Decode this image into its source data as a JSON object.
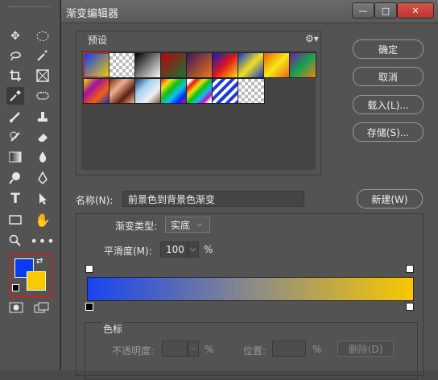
{
  "dialog": {
    "title": "渐变编辑器",
    "presets_label": "预设",
    "buttons": {
      "ok": "确定",
      "cancel": "取消",
      "load": "载入(L)...",
      "save": "存储(S)...",
      "new": "新建(W)"
    },
    "name_label": "名称(N):",
    "name_value": "前景色到背景色渐变",
    "gradient_type_label": "渐变类型:",
    "gradient_type_value": "实底",
    "smoothness_label": "平滑度(M):",
    "smoothness_value": "100",
    "smoothness_unit": "%",
    "stops_section_label": "色标",
    "opacity_label": "不透明度:",
    "opacity_unit": "%",
    "location_label": "位置:",
    "location_unit": "%",
    "delete_label": "删除(D)"
  },
  "colors": {
    "foreground": "#0a3cf8",
    "background": "#f8c800",
    "gradient_start": "#1844f0",
    "gradient_end": "#f9c800",
    "selection_highlight": "#d0201e"
  },
  "window_controls": {
    "minimize": "—",
    "maximize": "□",
    "close": "✕"
  },
  "presets": [
    {
      "id": "fg-to-bg",
      "css": "linear-gradient(135deg,#0a3cf8,#f8c800)",
      "selected": true
    },
    {
      "id": "fg-to-transparent",
      "css": "checker-blue"
    },
    {
      "id": "black-white",
      "css": "linear-gradient(135deg,#000,#fff)"
    },
    {
      "id": "red-green",
      "css": "linear-gradient(135deg,#c00010,#0b7a2e)"
    },
    {
      "id": "violet-orange",
      "css": "linear-gradient(135deg,#3a145a,#f07818)"
    },
    {
      "id": "blue-red-yellow",
      "css": "linear-gradient(135deg,#0b1cc0,#e01818,#f8e020)"
    },
    {
      "id": "blue-yellow-blue",
      "css": "linear-gradient(135deg,#1030d0,#f0e020,#1030d0)"
    },
    {
      "id": "orange-yellow-orange",
      "css": "linear-gradient(135deg,#e86010,#f8e818,#e86010)"
    },
    {
      "id": "violet-green-orange",
      "css": "linear-gradient(135deg,#7a18a0,#18a050,#f08018)"
    },
    {
      "id": "yellow-violet-orange-blue",
      "css": "linear-gradient(135deg,#f8e000,#a010a0,#f06010,#1030c0)"
    },
    {
      "id": "copper",
      "css": "linear-gradient(135deg,#6a2a10,#f0b090,#5a2010,#f0c0a0)"
    },
    {
      "id": "chrome",
      "css": "linear-gradient(135deg,#1a3a6a,#a0d0f0,#f0f0f0,#705030)"
    },
    {
      "id": "spectrum",
      "css": "linear-gradient(135deg,#f01010,#f0e010,#10c010,#10c0f0,#1020f0,#c010c0)"
    },
    {
      "id": "transparent-rainbow",
      "css": "checker-rainbow"
    },
    {
      "id": "transparent-stripes",
      "css": "stripes"
    },
    {
      "id": "transparent",
      "css": "checker"
    }
  ]
}
